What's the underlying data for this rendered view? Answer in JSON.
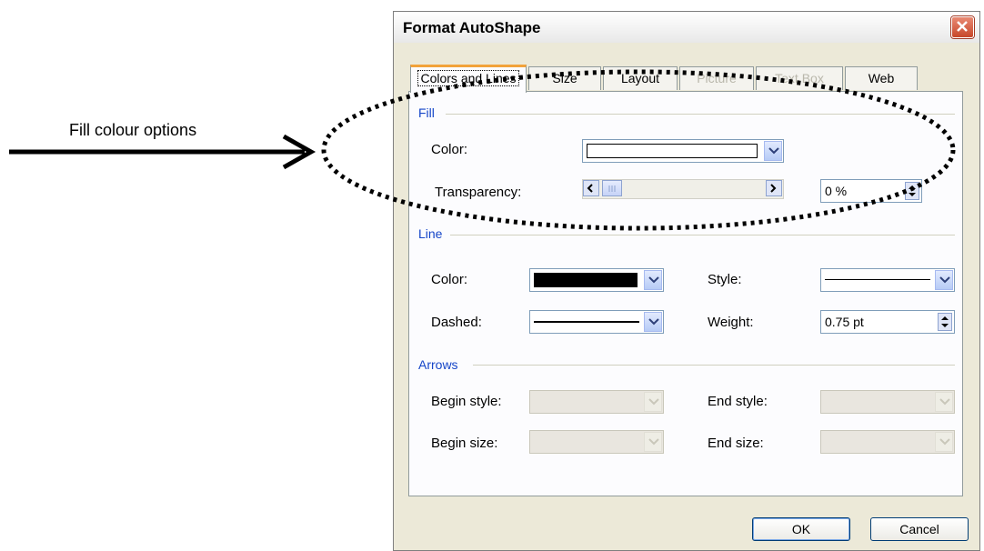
{
  "annotation": {
    "text": "Fill colour options"
  },
  "dialog": {
    "title": "Format AutoShape",
    "tabs": [
      {
        "label": "Colors and Lines",
        "state": "active"
      },
      {
        "label": "Size",
        "state": "normal"
      },
      {
        "label": "Layout",
        "state": "normal"
      },
      {
        "label": "Picture",
        "state": "disabled"
      },
      {
        "label": "Text Box",
        "state": "disabled"
      },
      {
        "label": "Web",
        "state": "normal"
      }
    ],
    "fill": {
      "section_title": "Fill",
      "color_label": "Color:",
      "color_value": "#ffffff",
      "transparency_label": "Transparency:",
      "transparency_value": "0 %"
    },
    "line": {
      "section_title": "Line",
      "color_label": "Color:",
      "color_value": "#000000",
      "style_label": "Style:",
      "dashed_label": "Dashed:",
      "weight_label": "Weight:",
      "weight_value": "0.75 pt"
    },
    "arrows": {
      "section_title": "Arrows",
      "begin_style_label": "Begin style:",
      "end_style_label": "End style:",
      "begin_size_label": "Begin size:",
      "end_size_label": "End size:"
    },
    "ok_label": "OK",
    "cancel_label": "Cancel"
  },
  "colors": {
    "section_blue": "#1646c8",
    "dialog_bg": "#ECE9D8",
    "active_tab_accent": "#f2a33a"
  }
}
